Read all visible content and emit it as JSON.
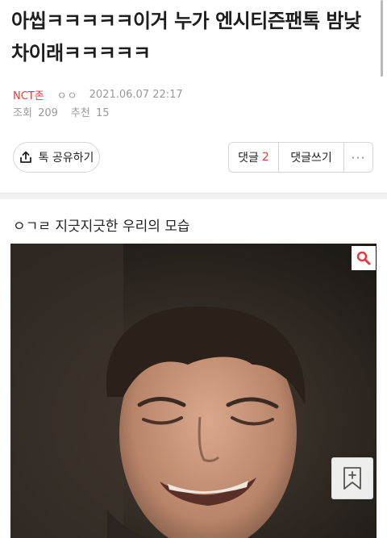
{
  "post": {
    "title": "아씹ㅋㅋㅋㅋㅋ이거 누가 엔시티즌팬톡 밤낮차이래ㅋㅋㅋㅋㅋ",
    "category": "NCT존",
    "author": "ㅇㅇ",
    "datetime": "2021.06.07 22:17",
    "views_label": "조회",
    "views": "209",
    "likes_label": "추천",
    "likes": "15",
    "body": "ㅇㄱㄹ 지긋지긋한 우리의 모습"
  },
  "actions": {
    "share_label": "톡 공유하기",
    "comments_label": "댓글",
    "comments_count": "2",
    "write_comment_label": "댓글쓰기",
    "more_label": "···"
  },
  "colors": {
    "accent": "#e8383d",
    "meta_text": "#999999",
    "divider": "#f2f2f2"
  },
  "icons": {
    "share": "share-icon",
    "zoom": "magnifier-icon",
    "bookmark": "bookmark-plus-icon"
  }
}
